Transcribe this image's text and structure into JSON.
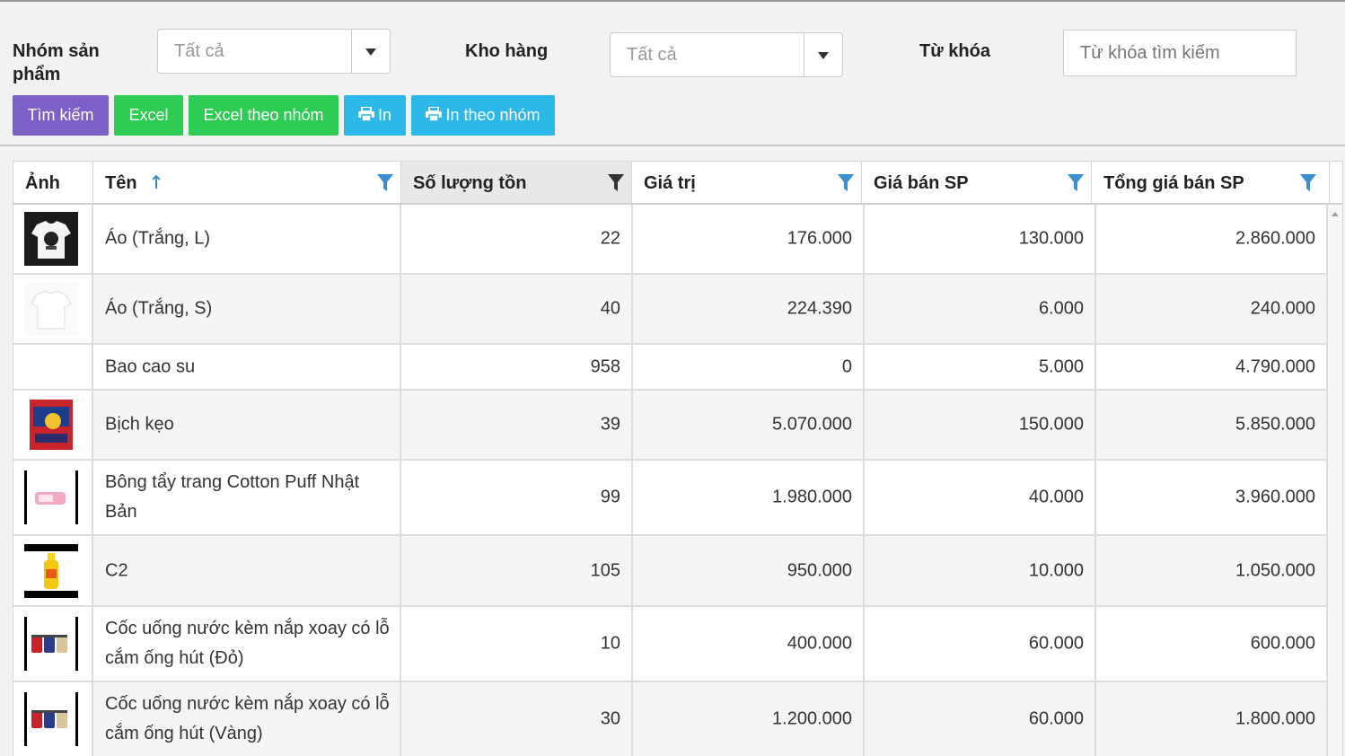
{
  "filters": {
    "group_label": "Nhóm sản phẩm",
    "group_value": "Tất cả",
    "warehouse_label": "Kho hàng",
    "warehouse_value": "Tất cả",
    "keyword_label": "Từ khóa",
    "keyword_placeholder": "Từ khóa tìm kiếm"
  },
  "buttons": {
    "search": "Tìm kiếm",
    "excel": "Excel",
    "excel_group": "Excel theo nhóm",
    "print": "In",
    "print_group": "In theo nhóm"
  },
  "colors": {
    "search": "#7b61c8",
    "excel": "#2ecc55",
    "print": "#2cb8e8"
  },
  "table": {
    "columns": [
      "Ảnh",
      "Tên",
      "Số lượng tồn",
      "Giá trị",
      "Giá bán SP",
      "Tổng giá bán SP"
    ],
    "sort": {
      "column": "Tên",
      "direction": "asc"
    },
    "rows": [
      {
        "image": "shirt-black-print",
        "name": "Áo (Trắng, L)",
        "qty": "22",
        "value": "176.000",
        "price": "130.000",
        "total": "2.860.000"
      },
      {
        "image": "shirt-white",
        "name": "Áo (Trắng, S)",
        "qty": "40",
        "value": "224.390",
        "price": "6.000",
        "total": "240.000"
      },
      {
        "image": "",
        "name": "Bao cao su",
        "qty": "958",
        "value": "0",
        "price": "5.000",
        "total": "4.790.000"
      },
      {
        "image": "candy-bag",
        "name": "Bịch kẹo",
        "qty": "39",
        "value": "5.070.000",
        "price": "150.000",
        "total": "5.850.000"
      },
      {
        "image": "cotton-pads",
        "name": "Bông tẩy trang Cotton Puff Nhật Bản",
        "qty": "99",
        "value": "1.980.000",
        "price": "40.000",
        "total": "3.960.000"
      },
      {
        "image": "bottle-yellow",
        "name": "C2",
        "qty": "105",
        "value": "950.000",
        "price": "10.000",
        "total": "1.050.000"
      },
      {
        "image": "cups",
        "name": "Cốc uống nước kèm nắp xoay có lỗ cắm ống hút (Đỏ)",
        "qty": "10",
        "value": "400.000",
        "price": "60.000",
        "total": "600.000"
      },
      {
        "image": "cups",
        "name": "Cốc uống nước kèm nắp xoay có lỗ cắm ống hút (Vàng)",
        "qty": "30",
        "value": "1.200.000",
        "price": "60.000",
        "total": "1.800.000"
      }
    ]
  }
}
